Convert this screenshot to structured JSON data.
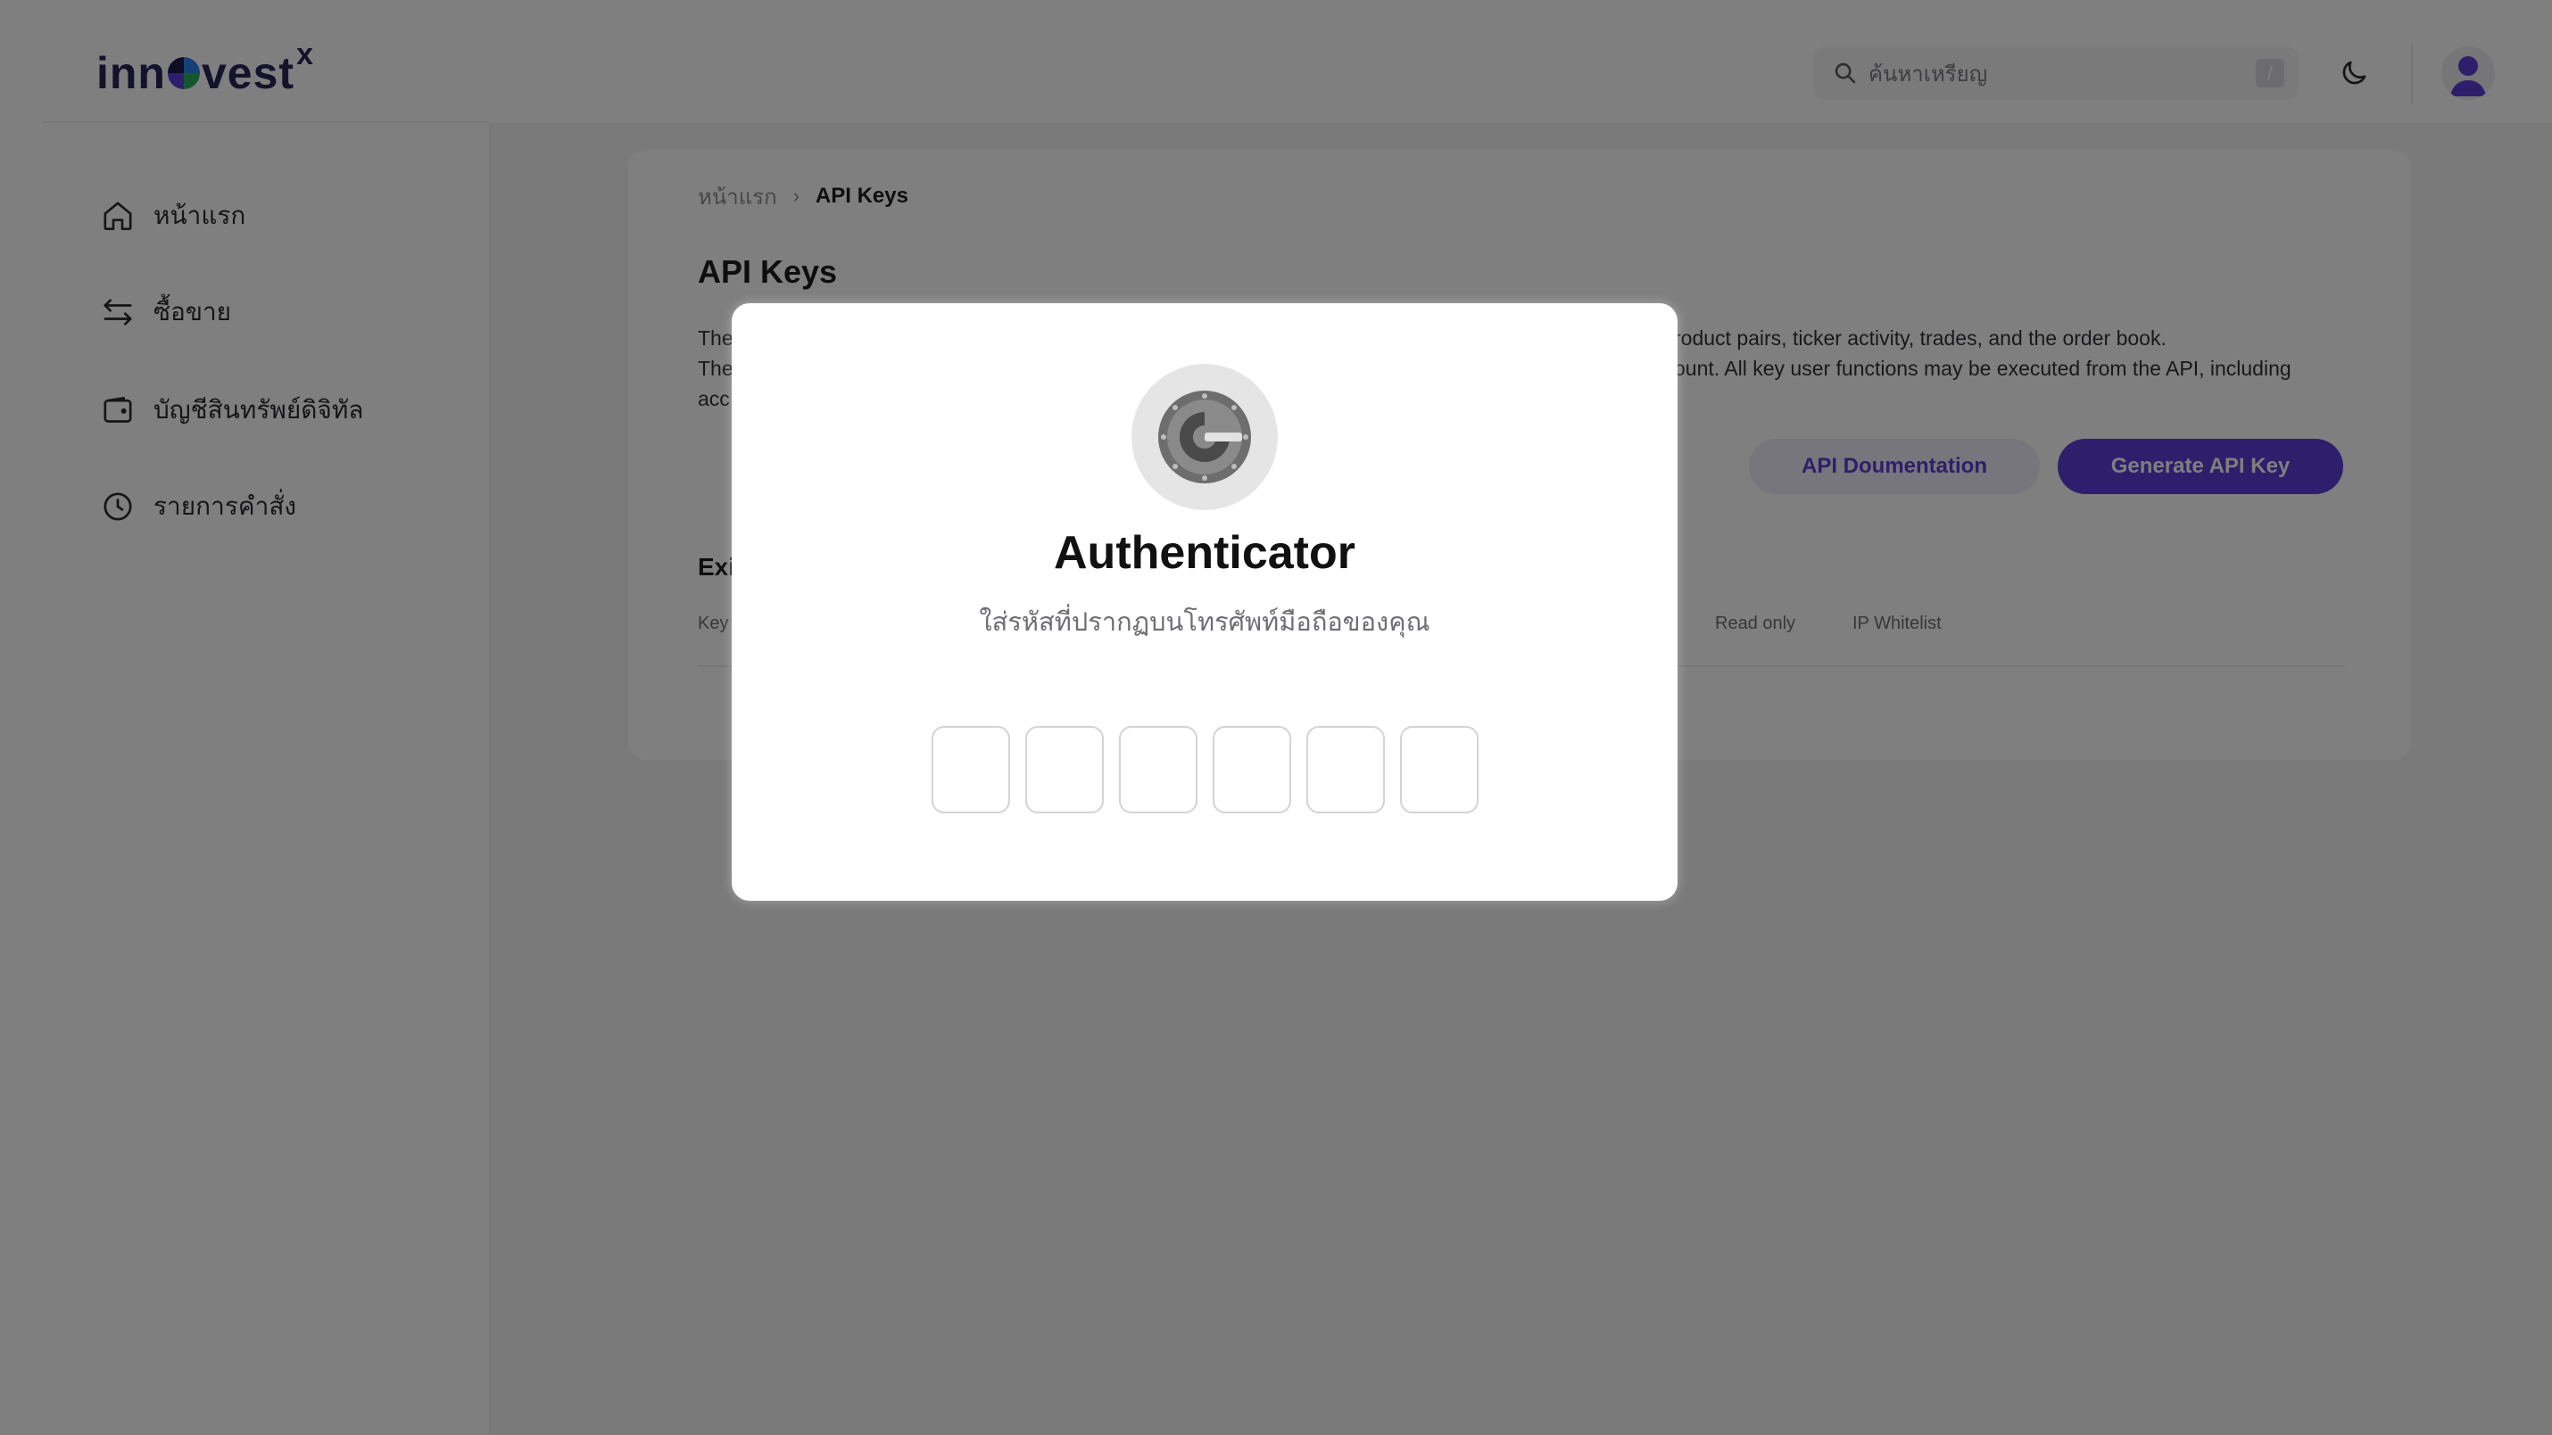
{
  "header": {
    "logo_text": "inn",
    "logo_text_end": "vest",
    "logo_mark": "x",
    "search_placeholder": "ค้นหาเหรียญ",
    "search_shortcut": "/"
  },
  "sidebar": {
    "items": [
      {
        "label": "หน้าแรก",
        "icon": "home-icon"
      },
      {
        "label": "ซื้อขาย",
        "icon": "swap-arrows-icon"
      },
      {
        "label": "บัญชีสินทรัพย์ดิจิทัล",
        "icon": "wallet-icon"
      },
      {
        "label": "รายการคำสั่ง",
        "icon": "clock-icon"
      }
    ]
  },
  "main": {
    "breadcrumb": {
      "home": "หน้าแรก",
      "current": "API Keys"
    },
    "title": "API Keys",
    "description": {
      "line1_start": "The",
      "line1_end": "roduct pairs, ticker activity, trades, and the order book.",
      "line2_start": "The",
      "line2_end": "ount. All key user functions may be executed from the API, including",
      "line3_start": "acc"
    },
    "buttons": {
      "docs": "API Doumentation",
      "generate": "Generate API Key"
    },
    "section_title": "Exi",
    "table_headers": {
      "key": "Key",
      "read_only": "Read only",
      "ip_whitelist": "IP Whitelist"
    }
  },
  "modal": {
    "title": "Authenticator",
    "subtitle": "ใส่รหัสที่ปรากฏบนโทรศัพท์มือถือของคุณ",
    "otp_digits": [
      "",
      "",
      "",
      "",
      "",
      ""
    ]
  },
  "colors": {
    "accent": "#5b3fd6",
    "brand_dark": "#2a2456",
    "overlay": "rgba(0,0,0,0.5)"
  }
}
